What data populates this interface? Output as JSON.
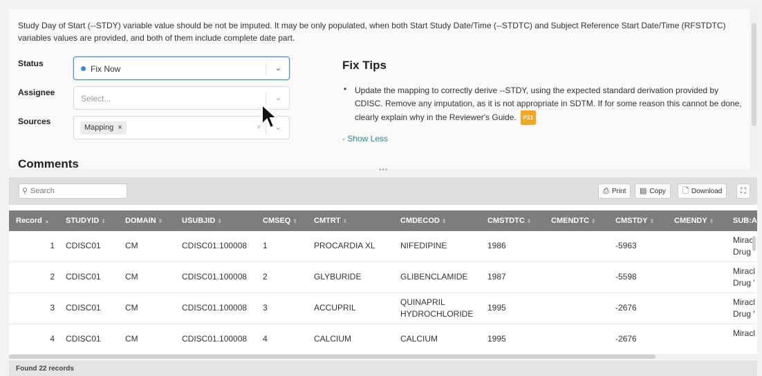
{
  "issue": {
    "description": "Study Day of Start (--STDY) variable value should be not be imputed. It may be only populated, when both Start Study Date/Time (--STDTC) and Subject Reference Start Date/Time (RFSTDTC) variables values are provided, and both of them include complete date part."
  },
  "form": {
    "status_label": "Status",
    "status_value": "Fix Now",
    "assignee_label": "Assignee",
    "assignee_placeholder": "Select...",
    "sources_label": "Sources",
    "sources_chip": "Mapping",
    "chip_remove": "×",
    "clear": "×",
    "chevron": "⌄"
  },
  "fix_tips": {
    "title": "Fix Tips",
    "bullet": "•",
    "text": "Update the mapping to correctly derive --STDY, using the expected standard derivation provided by CDISC. Remove any imputation, as it is not appropriate in SDTM. If for some reason this cannot be done, clearly explain why in the Reviewer's Guide.",
    "badge": "P21",
    "show_less": "- Show Less"
  },
  "comments": {
    "title": "Comments"
  },
  "splitter": {
    "dots": "•••"
  },
  "toolbar": {
    "search_placeholder": "Search",
    "print": "Print",
    "copy": "Copy",
    "download": "Download"
  },
  "table": {
    "columns": [
      "Record",
      "STUDYID",
      "DOMAIN",
      "USUBJID",
      "CMSEQ",
      "CMTRT",
      "CMDECOD",
      "CMSTDTC",
      "CMENDTC",
      "CMSTDY",
      "CMENDY",
      "SUB:AI"
    ],
    "sort_glyph": "⇕",
    "sort_active": "▲",
    "rows": [
      {
        "record": "1",
        "studyid": "CDISC01",
        "domain": "CM",
        "usubjid": "CDISC01.100008",
        "cmseq": "1",
        "cmtrt": "PROCARDIA XL",
        "cmdecod": "NIFEDIPINE",
        "cmstdtc": "1986",
        "cmendtc": "",
        "cmstdy": "-5963",
        "cmendy": "",
        "sub": "Miracl Drug '"
      },
      {
        "record": "2",
        "studyid": "CDISC01",
        "domain": "CM",
        "usubjid": "CDISC01.100008",
        "cmseq": "2",
        "cmtrt": "GLYBURIDE",
        "cmdecod": "GLIBENCLAMIDE",
        "cmstdtc": "1987",
        "cmendtc": "",
        "cmstdy": "-5598",
        "cmendy": "",
        "sub": "Miracl Drug '"
      },
      {
        "record": "3",
        "studyid": "CDISC01",
        "domain": "CM",
        "usubjid": "CDISC01.100008",
        "cmseq": "3",
        "cmtrt": "ACCUPRIL",
        "cmdecod": "QUINAPRIL HYDROCHLORIDE",
        "cmstdtc": "1995",
        "cmendtc": "",
        "cmstdy": "-2676",
        "cmendy": "",
        "sub": "Miracl Drug '"
      },
      {
        "record": "4",
        "studyid": "CDISC01",
        "domain": "CM",
        "usubjid": "CDISC01.100008",
        "cmseq": "4",
        "cmtrt": "CALCIUM",
        "cmdecod": "CALCIUM",
        "cmstdtc": "1995",
        "cmendtc": "",
        "cmstdy": "-2676",
        "cmendy": "",
        "sub": "Miracl"
      }
    ]
  },
  "footer": {
    "found": "Found 22 records"
  },
  "colors": {
    "header_bg": "#7d7d7d",
    "accent": "#3a8ad6",
    "badge": "#f5a623",
    "link": "#2a8a8a"
  }
}
